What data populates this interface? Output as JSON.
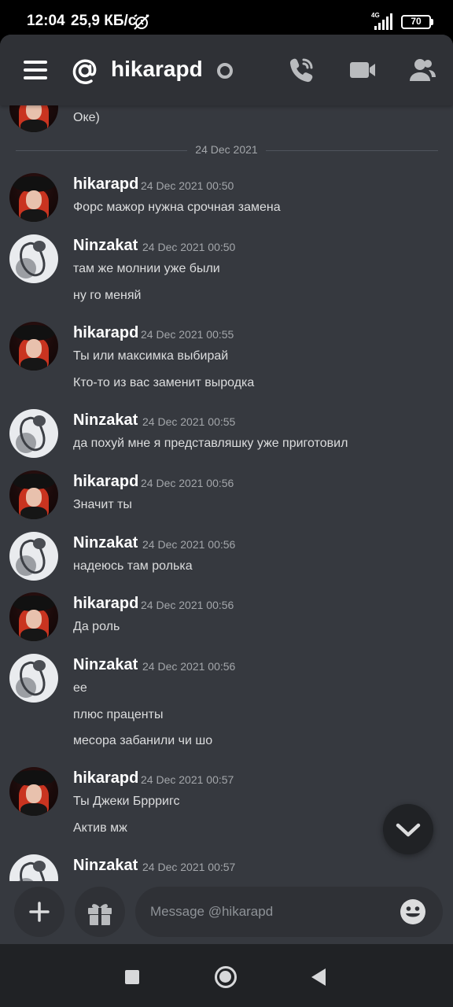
{
  "status_bar": {
    "time": "12:04",
    "speed": "25,9 КБ/с",
    "network": "4G",
    "battery": "70"
  },
  "header": {
    "menu_icon": "hamburger-icon",
    "at_icon": "at-icon",
    "title": "hikarapd",
    "status": "offline",
    "actions": [
      "phone-call-icon",
      "video-camera-icon",
      "members-icon"
    ]
  },
  "messages": {
    "prev_tail": "Оке)",
    "date_divider": "24 Dec 2021",
    "groups": [
      {
        "author": "hikarapd",
        "time": "24 Dec 2021 00:50",
        "lines": [
          "Форс мажор нужна срочная замена"
        ]
      },
      {
        "author": "Ninzakat",
        "time": "24 Dec 2021 00:50",
        "lines": [
          "там же молнии уже были",
          "ну го меняй"
        ]
      },
      {
        "author": "hikarapd",
        "time": "24 Dec 2021 00:55",
        "lines": [
          "Ты или максимка  выбирай",
          "Кто-то из вас заменит выродка"
        ]
      },
      {
        "author": "Ninzakat",
        "time": "24 Dec 2021 00:55",
        "lines": [
          "да похуй мне я представляшку уже приготовил"
        ]
      },
      {
        "author": "hikarapd",
        "time": "24 Dec 2021 00:56",
        "lines": [
          "Значит ты"
        ]
      },
      {
        "author": "Ninzakat",
        "time": "24 Dec 2021 00:56",
        "lines": [
          "надеюсь там ролька"
        ]
      },
      {
        "author": "hikarapd",
        "time": "24 Dec 2021 00:56",
        "lines": [
          "Да роль"
        ]
      },
      {
        "author": "Ninzakat",
        "time": "24 Dec 2021 00:56",
        "lines": [
          "ее",
          "плюс праценты",
          "месора забанили чи шо"
        ]
      },
      {
        "author": "hikarapd",
        "time": "24 Dec 2021 00:57",
        "lines": [
          "Ты Джеки Бррригс",
          "Актив мж"
        ]
      },
      {
        "author": "Ninzakat",
        "time": "24 Dec 2021 00:57",
        "lines": []
      }
    ]
  },
  "composer": {
    "placeholder": "Message @hikarapd",
    "add_icon": "plus-icon",
    "gift_icon": "gift-icon",
    "emoji_icon": "emoji-icon"
  },
  "colors": {
    "background": "#36393f",
    "header": "#2f3136",
    "text": "#dcddde",
    "timestamp": "#a3a6aa",
    "accent_avatar_hair": "#c93420"
  }
}
